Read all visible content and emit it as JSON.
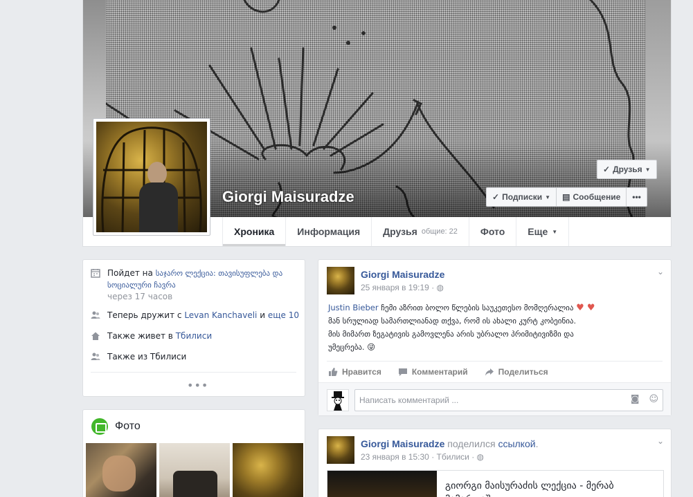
{
  "profile": {
    "name": "Giorgi Maisuradze",
    "friends_button": "Друзья",
    "subscribe_button": "Подписки",
    "message_button": "Сообщение",
    "more_button": "•••"
  },
  "tabs": [
    {
      "label": "Хроника"
    },
    {
      "label": "Информация"
    },
    {
      "label": "Друзья",
      "count": "общие: 22"
    },
    {
      "label": "Фото"
    },
    {
      "label": "Еще"
    }
  ],
  "about": {
    "event_prefix": "Пойдет на",
    "event_name_line1": "საჯარო ლექცია: თავისუფლება და",
    "event_name_line2": "სოციალური ჩავრა",
    "event_when": "через 17 часов",
    "friends_prefix": "Теперь дружит с",
    "friends_name": "Levan Kanchaveli",
    "friends_mid": "и",
    "friends_more": "еще 10",
    "lives_prefix": "Также живет в",
    "lives_city": "Тбилиси",
    "from_label": "Также из Тбилиси",
    "more": "•••"
  },
  "photos": {
    "title": "Фото"
  },
  "posts": [
    {
      "author": "Giorgi Maisuradze",
      "time": "25 января в 19:19",
      "privacy": "·",
      "mention": "Justin Bieber",
      "text_line1": "ჩემი აზრით ბოლო წლების საუკეთესო მომღერალია",
      "hearts": "♥ ♥",
      "text_line2": "მან სრულიად სამართლიანად თქვა, რომ ის ახალი კურტ კობეინია.",
      "text_line3": "მის მიმართ ზეგატივის გამოვლენა არის უბრალო პრიმიტივიზმი და",
      "text_line4": "უმეცრება.",
      "emoji": "😜",
      "like": "Нравится",
      "comment": "Комментарий",
      "share": "Поделиться",
      "comment_placeholder": "Написать комментарий ..."
    },
    {
      "author": "Giorgi Maisuradze",
      "shared_text": "поделился",
      "shared_link": "ссылкой",
      "shared_dot": ".",
      "time": "23 января в 15:30",
      "location": "Тбилиси",
      "privacy": "·",
      "link_title": "გიორგი მაისურაძის ლექცია - მერაბ მამარდაშვილი"
    }
  ],
  "colors": {
    "link": "#365899",
    "page_bg": "#e9ebee",
    "heart": "#e0574f",
    "photo_icon": "#42b72a"
  }
}
